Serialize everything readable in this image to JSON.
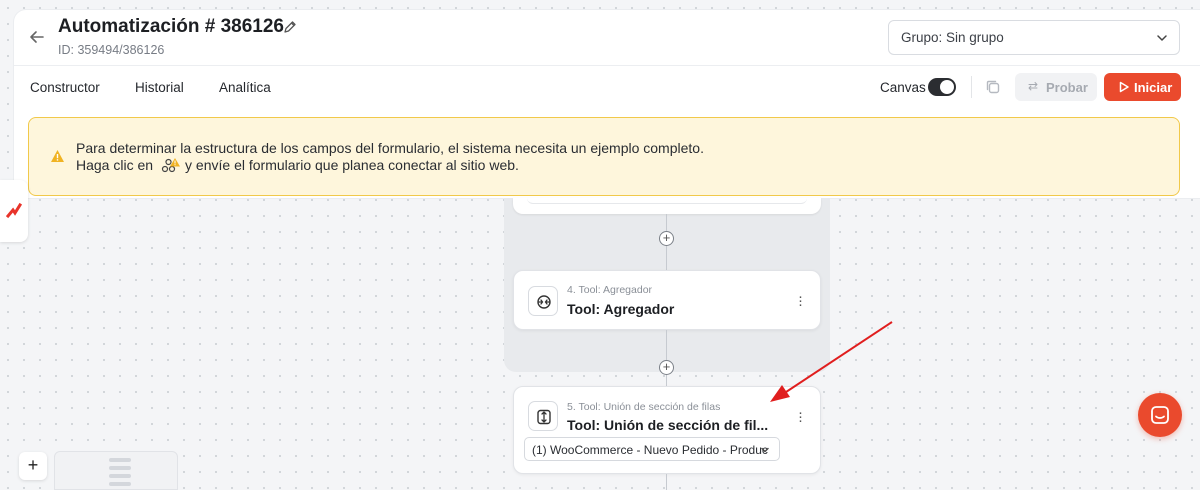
{
  "header": {
    "title": "Automatización # 386126",
    "id_label": "ID: 359494/386126",
    "group_select": "Grupo: Sin grupo"
  },
  "tabs": [
    {
      "label": "Constructor"
    },
    {
      "label": "Historial"
    },
    {
      "label": "Analítica"
    }
  ],
  "toolbar": {
    "canvas_label": "Canvas",
    "canvas_enabled": true,
    "probar_label": "Probar",
    "probar_symbol": "⇄",
    "iniciar_label": "Iniciar"
  },
  "alert": {
    "line1": "Para determinar la estructura de los campos del formulario, el sistema necesita un ejemplo completo.",
    "line2_before": "Haga clic en",
    "line2_after": "y envíe el formulario que planea conectar al sitio web."
  },
  "nodes": [
    {
      "step": "4. Tool: Agregador",
      "title": "Tool: Agregador",
      "icon": "aggregator-icon"
    },
    {
      "step": "5. Tool: Unión de sección de filas",
      "title": "Tool: Unión de sección de fil...",
      "icon": "row-union-icon",
      "dropdown": "(1) WooCommerce - Nuevo Pedido - Produc"
    }
  ],
  "colors": {
    "accent": "#ea4a2d",
    "alert_bg": "#fef6dc",
    "alert_border": "#f1c94a",
    "annotation_arrow": "#e01e1e"
  }
}
